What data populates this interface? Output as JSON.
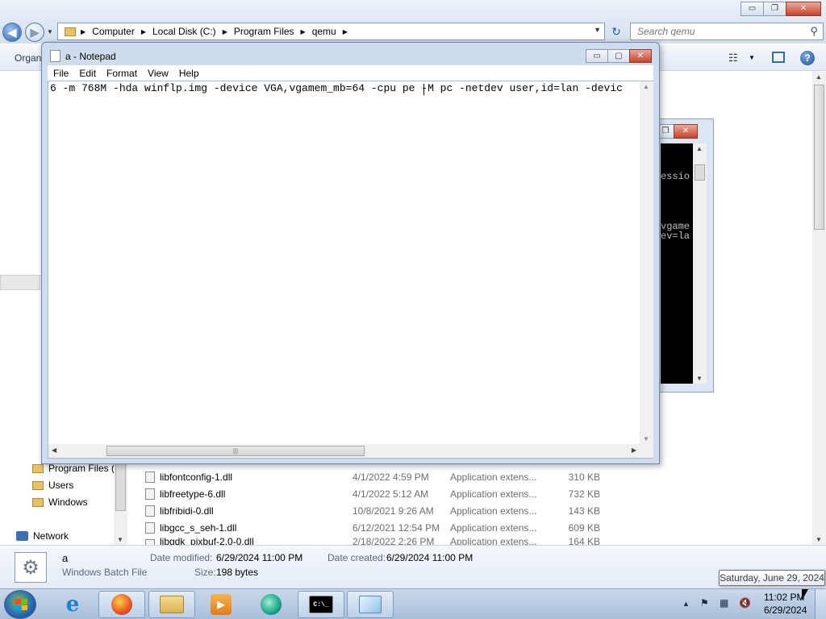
{
  "explorer": {
    "caption_buttons": {
      "minimize": "▭",
      "restore": "❐",
      "close": "✕"
    },
    "nav": {
      "back_glyph": "◀",
      "forward_glyph": "▶",
      "recent_glyph": "▼"
    },
    "breadcrumbs": [
      "Computer",
      "Local Disk (C:)",
      "Program Files",
      "qemu"
    ],
    "address_dropdown_glyph": "▼",
    "refresh_glyph": "↻",
    "search": {
      "placeholder": "Search qemu",
      "icon_glyph": "⚲"
    },
    "toolbar": {
      "organize_label": "Organ",
      "views_glyph": "☷",
      "views_arrow": "▼",
      "help_glyph": "?"
    },
    "nav_items": [
      {
        "label": "Program Files (",
        "icon": "folder-icon"
      },
      {
        "label": "Users",
        "icon": "folder-icon"
      },
      {
        "label": "Windows",
        "icon": "folder-icon"
      },
      {
        "label": "Network",
        "icon": "network-icon"
      }
    ],
    "files": [
      {
        "name": "libfontconfig-1.dll",
        "date": "4/1/2022 4:59 PM",
        "type": "Application extens...",
        "size": "310 KB"
      },
      {
        "name": "libfreetype-6.dll",
        "date": "4/1/2022 5:12 AM",
        "type": "Application extens...",
        "size": "732 KB"
      },
      {
        "name": "libfribidi-0.dll",
        "date": "10/8/2021 9:26 AM",
        "type": "Application extens...",
        "size": "143 KB"
      },
      {
        "name": "libgcc_s_seh-1.dll",
        "date": "6/12/2021 12:54 PM",
        "type": "Application extens...",
        "size": "609 KB"
      },
      {
        "name": "libgdk_pixbuf-2.0-0.dll",
        "date": "2/18/2022 2:26 PM",
        "type": "Application extens...",
        "size": "164 KB"
      }
    ],
    "details": {
      "name": "a",
      "type": "Windows Batch File",
      "date_modified_label": "Date modified:",
      "date_modified": "6/29/2024 11:00 PM",
      "size_label": "Size:",
      "size": "198 bytes",
      "date_created_label": "Date created:",
      "date_created": "6/29/2024 11:00 PM"
    }
  },
  "console": {
    "caption_buttons": {
      "restore": "❐",
      "close": "✕"
    },
    "lines": [
      "essio",
      "vgame",
      "ev=la"
    ]
  },
  "notepad": {
    "title": "a - Notepad",
    "caption_buttons": {
      "minimize": "▭",
      "maximize": "▢",
      "close": "✕"
    },
    "menu": [
      "File",
      "Edit",
      "Format",
      "View",
      "Help"
    ],
    "content": "6 -m 768M -hda winflp.img -device VGA,vgamem_mb=64 -cpu pe -M pc -netdev user,id=lan -devic",
    "hscroll_grip": "|||"
  },
  "taskbar": {
    "apps": [
      {
        "name": "internet-explorer",
        "glyph": "e",
        "active": false
      },
      {
        "name": "firefox",
        "glyph": "",
        "active": true
      },
      {
        "name": "windows-explorer",
        "glyph": "",
        "active": true
      },
      {
        "name": "media-player",
        "glyph": "▶",
        "active": false
      },
      {
        "name": "qemu",
        "glyph": "",
        "active": false
      },
      {
        "name": "command-prompt",
        "glyph": "C:\\_",
        "active": true
      },
      {
        "name": "notepad",
        "glyph": "",
        "active": true
      }
    ],
    "tray": {
      "show_hidden_glyph": "▲",
      "action_center_glyph": "⚑",
      "network_glyph": "▦",
      "volume_glyph": "🔇"
    },
    "clock": {
      "time": "11:02 PM",
      "date": "6/29/2024"
    },
    "tooltip": "Saturday, June 29, 2024"
  },
  "colors": {
    "start_flag": [
      "#f25022",
      "#7fba00",
      "#00a4ef",
      "#ffb900"
    ]
  }
}
